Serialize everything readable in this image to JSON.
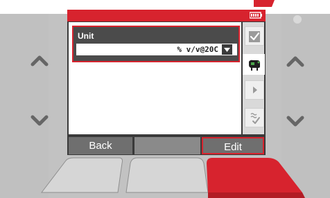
{
  "screen": {
    "unit_field_label": "Unit",
    "unit_value": "% v/v@20C"
  },
  "softkeys": {
    "left_label": "Back",
    "right_label": "Edit"
  },
  "icons": {
    "battery": "battery-icon",
    "tab_1": "checkmark-icon",
    "tab_2": "cow-icon",
    "tab_3": "arrow-right-icon",
    "tab_4": "steam-check-icon",
    "left_up": "chevron-up-icon",
    "left_down": "chevron-down-icon",
    "right_up": "chevron-up-icon",
    "right_down": "chevron-down-icon"
  },
  "colors": {
    "accent": "#d7232e",
    "bezel": "#bcbcbc",
    "screen_dark": "#3a3a3a"
  }
}
